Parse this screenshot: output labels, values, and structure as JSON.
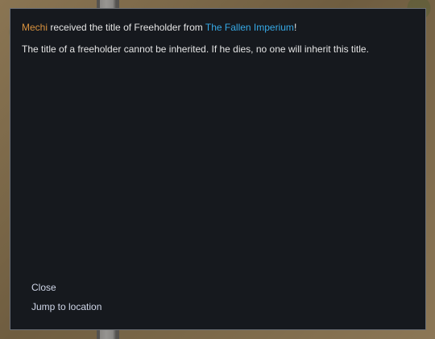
{
  "message": {
    "pawn_name": "Mechi",
    "text_before_faction": " received the title of Freeholder from ",
    "faction_name": "The Fallen Imperium",
    "text_end": "!",
    "body": "The title of a freeholder cannot be inherited. If he dies, no one will inherit this title."
  },
  "options": {
    "close_label": "Close",
    "jump_label": "Jump to location"
  },
  "colors": {
    "pawn_name": "#d9923e",
    "faction_name": "#36a9e6",
    "dialog_bg": "#16191e"
  }
}
